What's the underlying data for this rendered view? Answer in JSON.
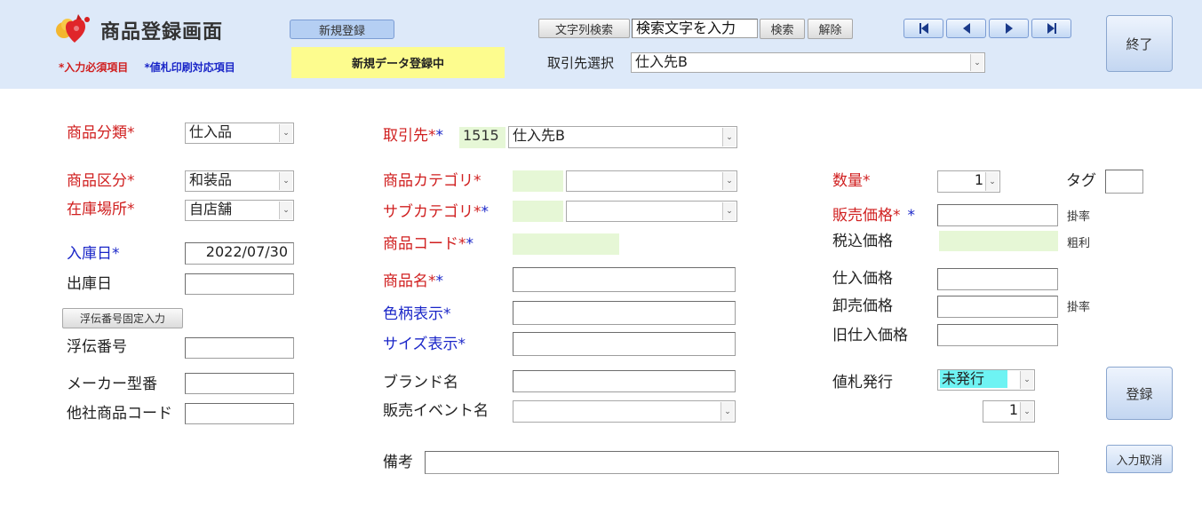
{
  "header": {
    "title": "商品登録画面",
    "legend_required": "入力必須項目",
    "legend_tag": "値札印刷対応項目",
    "new_button": "新規登録",
    "status": "新規データ登録中",
    "search_button": "文字列検索",
    "search_placeholder": "検索文字を入力",
    "find_button": "検索",
    "clear_button": "解除",
    "supplier_select_label": "取引先選択",
    "supplier_select_value": "仕入先B",
    "exit_button": "終了"
  },
  "left": {
    "category_label": "商品分類",
    "category_value": "仕入品",
    "division_label": "商品区分",
    "division_value": "和装品",
    "location_label": "在庫場所",
    "location_value": "自店舗",
    "arrival_label": "入庫日",
    "arrival_value": "2022/07/30",
    "shipping_label": "出庫日",
    "shipping_value": "",
    "slip_fixed_button": "浮伝番号固定入力",
    "slip_label": "浮伝番号",
    "slip_value": "",
    "maker_label": "メーカー型番",
    "maker_value": "",
    "other_code_label": "他社商品コード",
    "other_code_value": ""
  },
  "middle": {
    "supplier_label": "取引先",
    "supplier_code": "1515",
    "supplier_name": "仕入先B",
    "product_category_label": "商品カテゴリ",
    "sub_category_label": "サブカテゴリ",
    "product_code_label": "商品コード",
    "product_name_label": "商品名",
    "color_label": "色柄表示",
    "size_label": "サイズ表示",
    "brand_label": "ブランド名",
    "event_label": "販売イベント名",
    "notes_label": "備考"
  },
  "right": {
    "quantity_label": "数量",
    "quantity_value": "1",
    "tag_label": "タグ",
    "sale_price_label": "販売価格",
    "rate_label_1": "掛率",
    "tax_price_label": "税込価格",
    "margin_label": "粗利",
    "cost_label": "仕入価格",
    "wholesale_label": "卸売価格",
    "rate_label_2": "掛率",
    "old_cost_label": "旧仕入価格",
    "tag_issue_label": "値札発行",
    "tag_issue_value": "未発行",
    "tag_count_value": "1",
    "register_button": "登録",
    "cancel_button": "入力取消"
  },
  "symbols": {
    "star": "*"
  },
  "colors": {
    "header_bg": "#dde9f9",
    "required_red": "#d01f1f",
    "tag_blue": "#1a26c8",
    "status_yellow": "#fdfc8e",
    "auto_field_green": "#e6f7d6",
    "unissued_cyan": "#6ef3f3"
  },
  "icons": {
    "logo": "heart-flower-logo-icon",
    "nav": [
      "first-record-icon",
      "previous-record-icon",
      "next-record-icon",
      "last-record-icon"
    ]
  }
}
